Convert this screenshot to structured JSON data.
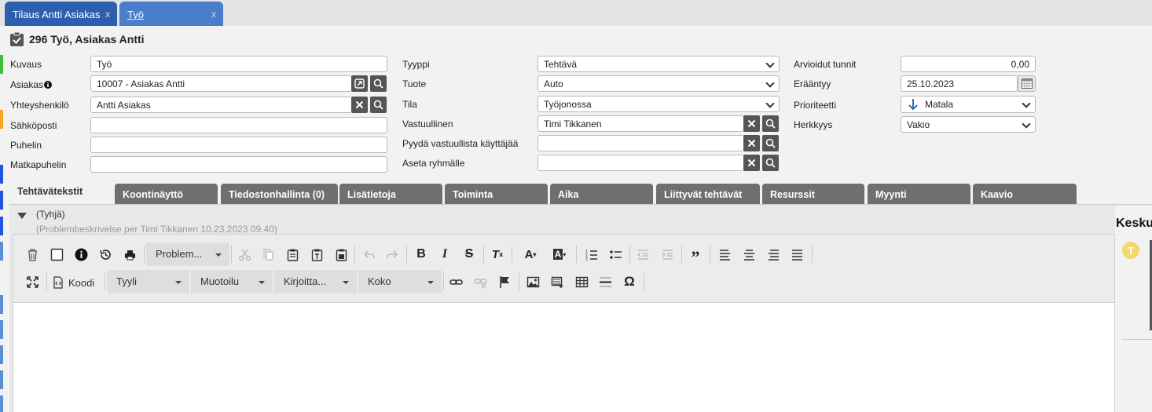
{
  "window_tabs": [
    {
      "label": "Tilaus Antti Asiakas",
      "close": "x"
    },
    {
      "label": "Työ",
      "close": "x"
    }
  ],
  "page_title": "296 Työ, Asiakas Antti",
  "form": {
    "kuvaus_label": "Kuvaus",
    "kuvaus_value": "Työ",
    "asiakas_label": "Asiakas",
    "asiakas_value": "10007 - Asiakas Antti",
    "yhteyshenkilo_label": "Yhteyshenkilö",
    "yhteyshenkilo_value": "Antti Asiakas",
    "sahkoposti_label": "Sähköposti",
    "sahkoposti_value": "",
    "puhelin_label": "Puhelin",
    "puhelin_value": "",
    "matkapuhelin_label": "Matkapuhelin",
    "matkapuhelin_value": "",
    "tyyppi_label": "Tyyppi",
    "tyyppi_value": "Tehtävä",
    "tuote_label": "Tuote",
    "tuote_value": "Auto",
    "tila_label": "Tila",
    "tila_value": "Työjonossa",
    "vastuullinen_label": "Vastuullinen",
    "vastuullinen_value": "Timi Tikkanen",
    "pyyda_label": "Pyydä vastuullista käyttäjää",
    "pyyda_value": "",
    "aseta_label": "Aseta ryhmälle",
    "aseta_value": "",
    "arvioidut_label": "Arvioidut tunnit",
    "arvioidut_value": "0,00",
    "eraantyy_label": "Erääntyy",
    "eraantyy_value": "25.10.2023",
    "prioriteetti_label": "Prioriteetti",
    "prioriteetti_value": "Matala",
    "herkkyys_label": "Herkkyys",
    "herkkyys_value": "Vakio"
  },
  "content_tabs": [
    "Tehtävätekstit",
    "Koontinäyttö",
    "Tiedostonhallinta (0)",
    "Lisätietoja",
    "Toiminta",
    "Aika",
    "Liittyvät tehtävät",
    "Resurssit",
    "Myynti",
    "Kaavio"
  ],
  "description": {
    "empty_label": "(Tyhjä)",
    "meta": "(Problembeskrivelse per Timi Tikkanen 10.23.2023 09.40)"
  },
  "editor": {
    "template_dropdown": "Problem...",
    "code_label": "Koodi",
    "style_dropdown": "Tyyli",
    "format_dropdown": "Muotoilu",
    "font_dropdown": "Kirjoitta...",
    "size_dropdown": "Koko"
  },
  "right_panel": {
    "title": "Kesku",
    "avatar_letter": "T"
  },
  "colors": {
    "tab_dark": "#2d5fae",
    "tab_active": "#4a7dcb",
    "content_tab": "#6f6f6f",
    "priority_arrow": "#2f6dbf",
    "avatar": "#f5d76e"
  }
}
